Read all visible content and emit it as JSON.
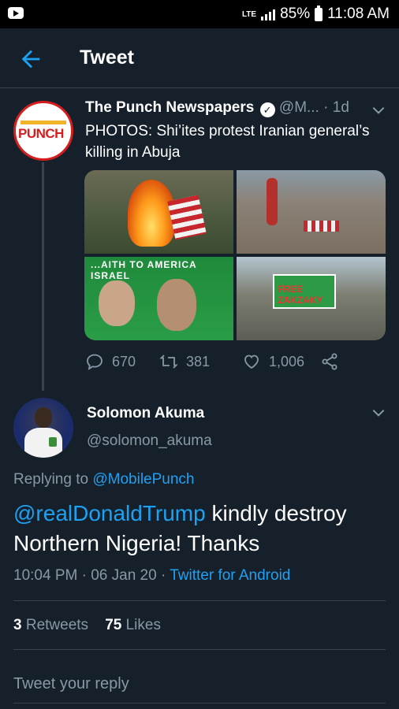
{
  "status_bar": {
    "network": "LTE",
    "battery": "85%",
    "time": "11:08 AM"
  },
  "header": {
    "title": "Tweet"
  },
  "quoted_tweet": {
    "name": "The Punch Newspapers",
    "handle": "@M...",
    "separator": "·",
    "age": "1d",
    "avatar_text": "PUNCH",
    "text": "PHOTOS: Shi’ites protest Iranian general’s killing in Abuja",
    "photo3_banner": "...AITH TO AMERICA   ISRAEL",
    "photo4_sign": "FREE ZAKZAKY",
    "actions": {
      "replies": "670",
      "retweets": "381",
      "likes": "1,006"
    }
  },
  "tweet": {
    "name": "Solomon Akuma",
    "handle": "@solomon_akuma",
    "replying_prefix": "Replying to",
    "replying_to": "@MobilePunch",
    "mention": "@realDonaldTrump",
    "text": " kindly destroy Northern Nigeria! Thanks",
    "time": "10:04 PM",
    "date": "06 Jan 20",
    "dot": "·",
    "source": "Twitter for Android",
    "retweets_count": "3",
    "retweets_label": "Retweets",
    "likes_count": "75",
    "likes_label": "Likes"
  },
  "reply_placeholder": "Tweet your reply",
  "colors": {
    "background": "#15202b",
    "accent": "#1da1f2",
    "muted": "#8899a6",
    "divider": "#38444d"
  }
}
